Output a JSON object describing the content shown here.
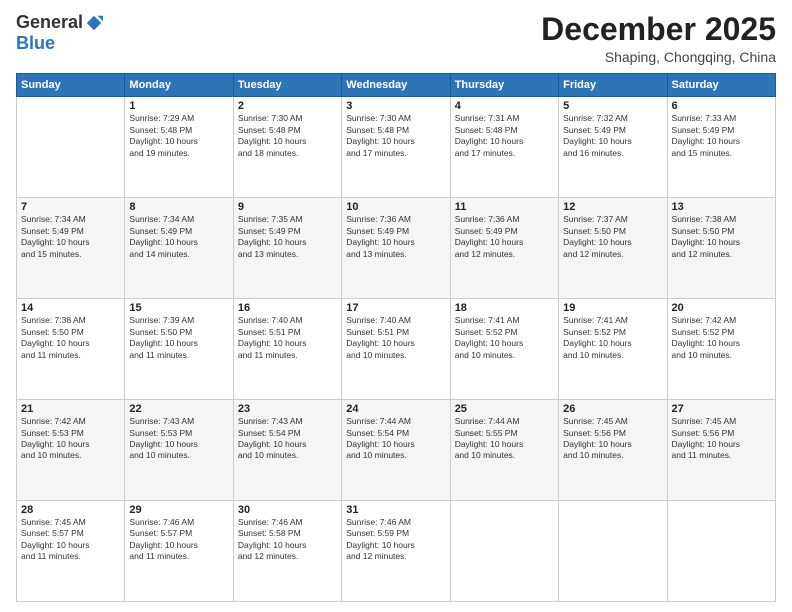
{
  "logo": {
    "general": "General",
    "blue": "Blue"
  },
  "title": "December 2025",
  "location": "Shaping, Chongqing, China",
  "weekdays": [
    "Sunday",
    "Monday",
    "Tuesday",
    "Wednesday",
    "Thursday",
    "Friday",
    "Saturday"
  ],
  "weeks": [
    [
      {
        "day": "",
        "info": ""
      },
      {
        "day": "1",
        "info": "Sunrise: 7:29 AM\nSunset: 5:48 PM\nDaylight: 10 hours\nand 19 minutes."
      },
      {
        "day": "2",
        "info": "Sunrise: 7:30 AM\nSunset: 5:48 PM\nDaylight: 10 hours\nand 18 minutes."
      },
      {
        "day": "3",
        "info": "Sunrise: 7:30 AM\nSunset: 5:48 PM\nDaylight: 10 hours\nand 17 minutes."
      },
      {
        "day": "4",
        "info": "Sunrise: 7:31 AM\nSunset: 5:48 PM\nDaylight: 10 hours\nand 17 minutes."
      },
      {
        "day": "5",
        "info": "Sunrise: 7:32 AM\nSunset: 5:49 PM\nDaylight: 10 hours\nand 16 minutes."
      },
      {
        "day": "6",
        "info": "Sunrise: 7:33 AM\nSunset: 5:49 PM\nDaylight: 10 hours\nand 15 minutes."
      }
    ],
    [
      {
        "day": "7",
        "info": "Sunrise: 7:34 AM\nSunset: 5:49 PM\nDaylight: 10 hours\nand 15 minutes."
      },
      {
        "day": "8",
        "info": "Sunrise: 7:34 AM\nSunset: 5:49 PM\nDaylight: 10 hours\nand 14 minutes."
      },
      {
        "day": "9",
        "info": "Sunrise: 7:35 AM\nSunset: 5:49 PM\nDaylight: 10 hours\nand 13 minutes."
      },
      {
        "day": "10",
        "info": "Sunrise: 7:36 AM\nSunset: 5:49 PM\nDaylight: 10 hours\nand 13 minutes."
      },
      {
        "day": "11",
        "info": "Sunrise: 7:36 AM\nSunset: 5:49 PM\nDaylight: 10 hours\nand 12 minutes."
      },
      {
        "day": "12",
        "info": "Sunrise: 7:37 AM\nSunset: 5:50 PM\nDaylight: 10 hours\nand 12 minutes."
      },
      {
        "day": "13",
        "info": "Sunrise: 7:38 AM\nSunset: 5:50 PM\nDaylight: 10 hours\nand 12 minutes."
      }
    ],
    [
      {
        "day": "14",
        "info": "Sunrise: 7:38 AM\nSunset: 5:50 PM\nDaylight: 10 hours\nand 11 minutes."
      },
      {
        "day": "15",
        "info": "Sunrise: 7:39 AM\nSunset: 5:50 PM\nDaylight: 10 hours\nand 11 minutes."
      },
      {
        "day": "16",
        "info": "Sunrise: 7:40 AM\nSunset: 5:51 PM\nDaylight: 10 hours\nand 11 minutes."
      },
      {
        "day": "17",
        "info": "Sunrise: 7:40 AM\nSunset: 5:51 PM\nDaylight: 10 hours\nand 10 minutes."
      },
      {
        "day": "18",
        "info": "Sunrise: 7:41 AM\nSunset: 5:52 PM\nDaylight: 10 hours\nand 10 minutes."
      },
      {
        "day": "19",
        "info": "Sunrise: 7:41 AM\nSunset: 5:52 PM\nDaylight: 10 hours\nand 10 minutes."
      },
      {
        "day": "20",
        "info": "Sunrise: 7:42 AM\nSunset: 5:52 PM\nDaylight: 10 hours\nand 10 minutes."
      }
    ],
    [
      {
        "day": "21",
        "info": "Sunrise: 7:42 AM\nSunset: 5:53 PM\nDaylight: 10 hours\nand 10 minutes."
      },
      {
        "day": "22",
        "info": "Sunrise: 7:43 AM\nSunset: 5:53 PM\nDaylight: 10 hours\nand 10 minutes."
      },
      {
        "day": "23",
        "info": "Sunrise: 7:43 AM\nSunset: 5:54 PM\nDaylight: 10 hours\nand 10 minutes."
      },
      {
        "day": "24",
        "info": "Sunrise: 7:44 AM\nSunset: 5:54 PM\nDaylight: 10 hours\nand 10 minutes."
      },
      {
        "day": "25",
        "info": "Sunrise: 7:44 AM\nSunset: 5:55 PM\nDaylight: 10 hours\nand 10 minutes."
      },
      {
        "day": "26",
        "info": "Sunrise: 7:45 AM\nSunset: 5:56 PM\nDaylight: 10 hours\nand 10 minutes."
      },
      {
        "day": "27",
        "info": "Sunrise: 7:45 AM\nSunset: 5:56 PM\nDaylight: 10 hours\nand 11 minutes."
      }
    ],
    [
      {
        "day": "28",
        "info": "Sunrise: 7:45 AM\nSunset: 5:57 PM\nDaylight: 10 hours\nand 11 minutes."
      },
      {
        "day": "29",
        "info": "Sunrise: 7:46 AM\nSunset: 5:57 PM\nDaylight: 10 hours\nand 11 minutes."
      },
      {
        "day": "30",
        "info": "Sunrise: 7:46 AM\nSunset: 5:58 PM\nDaylight: 10 hours\nand 12 minutes."
      },
      {
        "day": "31",
        "info": "Sunrise: 7:46 AM\nSunset: 5:59 PM\nDaylight: 10 hours\nand 12 minutes."
      },
      {
        "day": "",
        "info": ""
      },
      {
        "day": "",
        "info": ""
      },
      {
        "day": "",
        "info": ""
      }
    ]
  ]
}
